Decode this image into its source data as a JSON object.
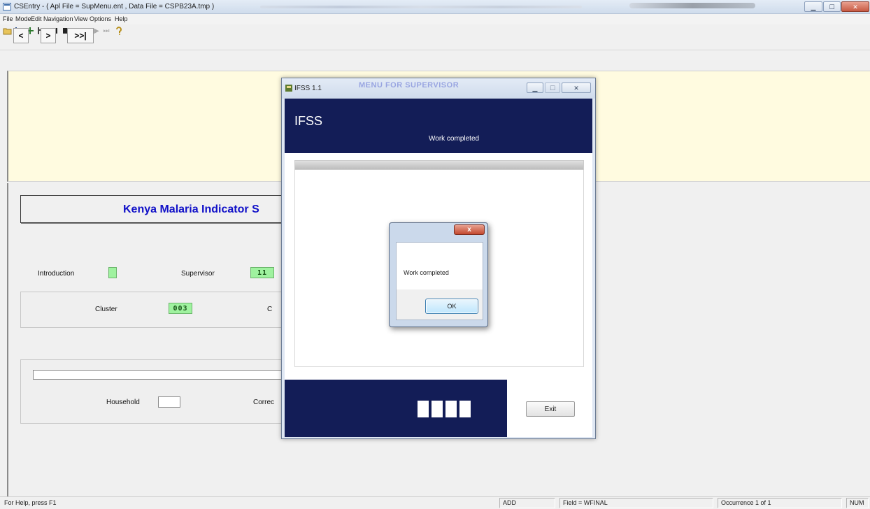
{
  "main_window": {
    "title": "CSEntry - ( Apl File = SupMenu.ent , Data File = CSPB23A.tmp )",
    "menu": [
      "File",
      "Mode",
      "Edit",
      "Navigation",
      "View",
      "Options",
      "Help"
    ],
    "toolbar_icons": [
      "open-icon",
      "add-mode-icon",
      "modify-mode-icon",
      "verify-mode-icon",
      "pause-icon",
      "stop-icon",
      "first-case-icon",
      "previous-case-icon",
      "next-case-icon",
      "last-case-icon",
      "help-icon"
    ],
    "nav_buttons": [
      "<",
      ">",
      ">>|"
    ]
  },
  "form": {
    "survey_title": "Kenya Malaria Indicator S",
    "introduction_label": "Introduction",
    "supervisor_label": "Supervisor",
    "supervisor_value": "11",
    "cluster_label": "Cluster",
    "cluster_value": "003",
    "cluster_next_label_partial": "C",
    "household_label": "Household",
    "correct_label_partial": "Correc"
  },
  "ifss_window": {
    "title": "IFSS 1.1",
    "header_title": "IFSS",
    "header_status": "Work completed",
    "exit_label": "Exit"
  },
  "message_box": {
    "close_glyph": "x",
    "message": "Work completed",
    "ok_label": "OK"
  },
  "status_bar": {
    "help_text": "For Help, press F1",
    "mode": "ADD",
    "field": "Field = WFINAL",
    "occurrence": "Occurrence 1 of 1",
    "num": "NUM"
  },
  "colors": {
    "banner_navy": "#131d57",
    "title_blue": "#1010c8",
    "field_green": "#9ff29f",
    "yellow_area": "#fffbe0"
  }
}
